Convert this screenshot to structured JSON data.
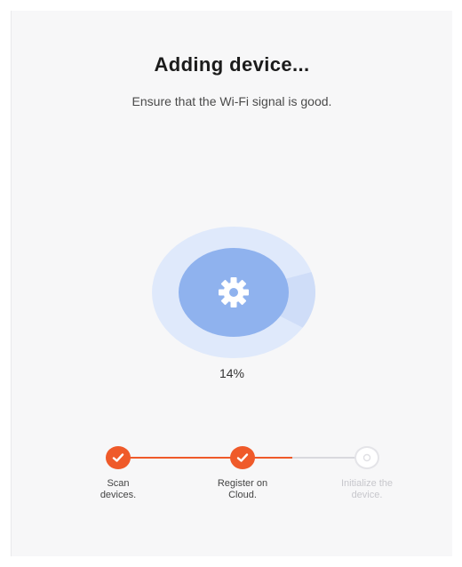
{
  "header": {
    "title": "Adding device...",
    "subtitle": "Ensure that the Wi-Fi signal is good."
  },
  "progress": {
    "value": 14,
    "label": "14%",
    "icon": "gear-icon"
  },
  "steps": [
    {
      "line1": "Scan",
      "line2": "devices.",
      "status": "done"
    },
    {
      "line1": "Register on",
      "line2": "Cloud.",
      "status": "done"
    },
    {
      "line1": "Initialize the",
      "line2": "device.",
      "status": "pending"
    }
  ],
  "colors": {
    "accent": "#ef5a2a",
    "ring_outer": "#dfe9fb",
    "ring_inner": "#bcd2f6",
    "core": "#8fb2ee",
    "pending": "#d9d9de"
  }
}
